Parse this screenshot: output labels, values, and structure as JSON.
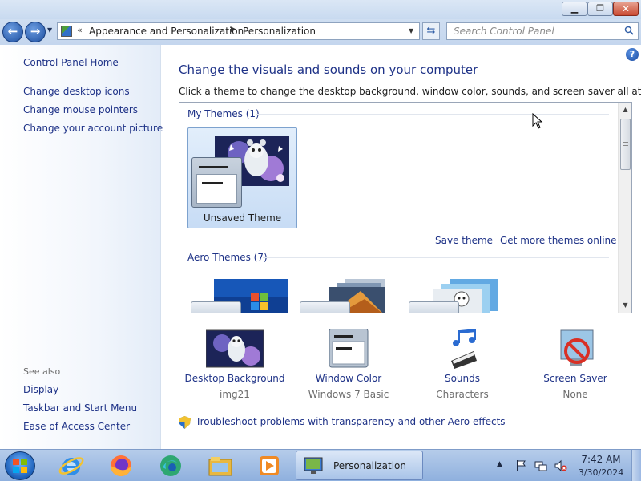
{
  "window": {
    "min_glyph": "▁",
    "max_glyph": "❐",
    "close_glyph": "✕"
  },
  "nav": {
    "back_glyph": "←",
    "forward_glyph": "→",
    "chevron": "«",
    "crumbs": [
      "Appearance and Personalization",
      "Personalization"
    ],
    "crumb_sep": "▶",
    "dropdown_glyph": "▼",
    "refresh_glyph": "⇆",
    "search_placeholder": "Search Control Panel"
  },
  "sidebar": {
    "home": "Control Panel Home",
    "tasks": [
      "Change desktop icons",
      "Change mouse pointers",
      "Change your account picture"
    ],
    "see_also_label": "See also",
    "see_also": [
      "Display",
      "Taskbar and Start Menu",
      "Ease of Access Center"
    ]
  },
  "main": {
    "help_glyph": "?",
    "title": "Change the visuals and sounds on your computer",
    "subtitle": "Click a theme to change the desktop background, window color, sounds, and screen saver all at once.",
    "my_themes_label": "My Themes (1)",
    "saved_theme_name": "Unsaved Theme",
    "save_theme": "Save theme",
    "get_more": "Get more themes online",
    "aero_label": "Aero Themes (7)",
    "scroll_up": "▲",
    "scroll_down": "▼"
  },
  "settings": [
    {
      "label": "Desktop Background",
      "value": "img21"
    },
    {
      "label": "Window Color",
      "value": "Windows 7 Basic"
    },
    {
      "label": "Sounds",
      "value": "Characters"
    },
    {
      "label": "Screen Saver",
      "value": "None"
    }
  ],
  "troubleshoot": "Troubleshoot problems with transparency and other Aero effects",
  "taskbar": {
    "task_label": "Personalization",
    "tray_arrow": "▲",
    "time": "7:42 AM",
    "date": "3/30/2024"
  },
  "colors": {
    "link": "#1e3287",
    "accent": "#3a7bd5",
    "taskbar": "#9db9e3"
  }
}
